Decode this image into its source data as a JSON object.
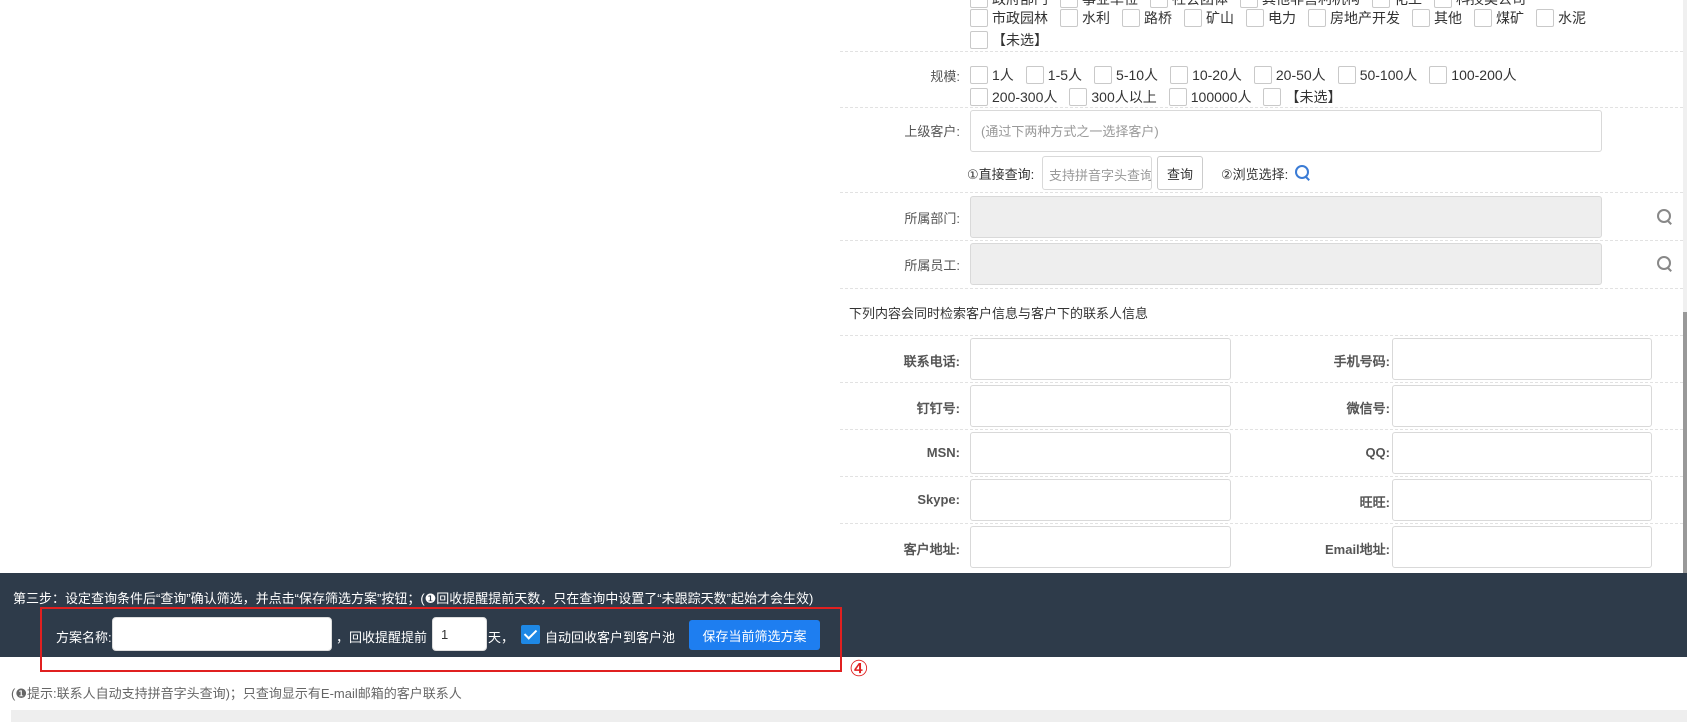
{
  "industry": {
    "row0_options": [
      "政府部门",
      "事业单位",
      "社会团体",
      "其他非营利机构",
      "化工",
      "科技类公司"
    ],
    "row1_options": [
      "市政园林",
      "水利",
      "路桥",
      "矿山",
      "电力",
      "房地产开发",
      "其他",
      "煤矿",
      "水泥"
    ],
    "row2_options": [
      "【未选】"
    ]
  },
  "scale": {
    "label": "规模:",
    "row1_options": [
      "1人",
      "1-5人",
      "5-10人",
      "10-20人",
      "20-50人",
      "50-100人",
      "100-200人"
    ],
    "row2_options": [
      "200-300人",
      "300人以上",
      "100000人",
      "【未选】"
    ]
  },
  "parent_customer": {
    "label": "上级客户:",
    "placeholder": "(通过下两种方式之一选择客户)",
    "direct_label": "①直接查询:",
    "direct_placeholder": "支持拼音字头查询",
    "query_button": "查询",
    "browse_label": "②浏览选择:"
  },
  "department": {
    "label": "所属部门:"
  },
  "employee": {
    "label": "所属员工:"
  },
  "contact_note": "下列内容会同时检索客户信息与客户下的联系人信息",
  "contact_fields": [
    {
      "left": "联系电话:",
      "right": "手机号码:"
    },
    {
      "left": "钉钉号:",
      "right": "微信号:"
    },
    {
      "left": "MSN:",
      "right": "QQ:"
    },
    {
      "left": "Skype:",
      "right": "旺旺:"
    },
    {
      "left": "客户地址:",
      "right": "Email地址:"
    }
  ],
  "footer": {
    "step_text": "第三步：设定查询条件后“查询”确认筛选，并点击“保存筛选方案”按钮；(❶回收提醒提前天数，只在查询中设置了“未跟踪天数”起始才会生效)",
    "plan_name_label": "方案名称:",
    "plan_name_value": "",
    "reminder_label": "，回收提醒提前",
    "reminder_days": "1",
    "days_unit": "天，",
    "auto_recycle_label": "自动回收客户到客户池",
    "auto_recycle_checked": true,
    "save_button": "保存当前筛选方案"
  },
  "marker": "④",
  "hint": "(❶提示:联系人自动支持拼音字头查询)；只查询显示有E-mail邮箱的客户联系人",
  "colors": {
    "footer_bg": "#2e3b4a",
    "primary": "#1e7ef0",
    "highlight": "#e02020"
  }
}
